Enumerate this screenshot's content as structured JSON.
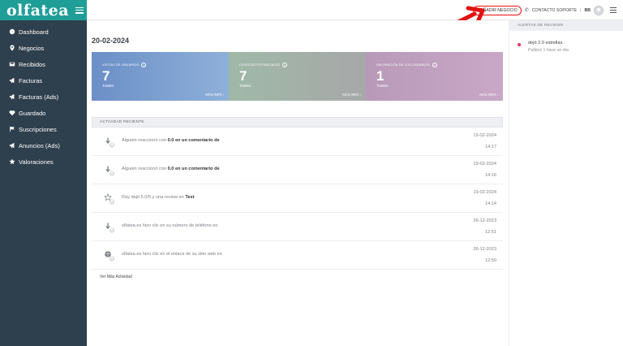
{
  "brand": {
    "logo": "olfatea"
  },
  "sidebar": {
    "items": [
      {
        "label": "Dashboard",
        "icon": "dashboard-icon"
      },
      {
        "label": "Negocios",
        "icon": "map-pin-icon"
      },
      {
        "label": "Recibidos",
        "icon": "envelope-icon"
      },
      {
        "label": "Facturas",
        "icon": "megaphone-icon"
      },
      {
        "label": "Facturas (Ads)",
        "icon": "megaphone-icon"
      },
      {
        "label": "Guardado",
        "icon": "heart-icon"
      },
      {
        "label": "Suscripciones",
        "icon": "flag-icon"
      },
      {
        "label": "Anuncios (Ads)",
        "icon": "megaphone-icon"
      },
      {
        "label": "Valoraciones",
        "icon": "star-icon"
      }
    ]
  },
  "topbar": {
    "add_business": "+ AÑADIR NEGOCIO",
    "contact_support": "CONTACTO SOPORTE",
    "separator": "|",
    "user_initials": "BB"
  },
  "main": {
    "date": "20-02-2024",
    "stats": [
      {
        "label": "VISITAS DE USUARIOS",
        "value": "7",
        "sub": "Totales",
        "more": "MÁS INFO  ›"
      },
      {
        "label": "CLIENTES POTENCIALES",
        "value": "7",
        "sub": "Totales",
        "more": "MÁS INFO  ›"
      },
      {
        "label": "VALORACIÓN DE LOS USUARIOS",
        "value": "1",
        "sub": "Totales",
        "more": "MÁS INFO  ›"
      }
    ],
    "activity": {
      "title": "ACTIVIDAD RECIENTE",
      "rows": [
        {
          "icon": "thumb-icon",
          "prefix": "Alguien reaccionó con ",
          "bold": "0.0 en un comentario de",
          "date": "19-02-2024",
          "time": "14:17"
        },
        {
          "icon": "thumb-icon",
          "prefix": "Alguien reaccionó con ",
          "bold": "0.0 en un comentario de",
          "date": "19-02-2024",
          "time": "14:16"
        },
        {
          "icon": "star-outline-icon",
          "prefix": "Ray dejó 5.0/5 y una review en ",
          "bold": "Test",
          "date": "19-02-2024",
          "time": "14:14"
        },
        {
          "icon": "thumb-icon",
          "prefix": "olfatea.es hizo clic en su número de teléfono en",
          "bold": "",
          "date": "26-12-2023",
          "time": "12:51"
        },
        {
          "icon": "globe-icon",
          "prefix": "olfatea.es hizo clic en el enlace de su sitio web en",
          "bold": "",
          "date": "26-12-2023",
          "time": "12:50"
        }
      ],
      "see_more": "Ver Más Actividad"
    }
  },
  "reviews_panel": {
    "title": "ALERTAS DE REVIEWS",
    "item": {
      "text": "dejó 2.0 estrellas.",
      "sub": "Publicó 1 hace un día"
    }
  },
  "colors": {
    "brand": "#1f9e98",
    "sidebar": "#2e3f4d",
    "annotation": "#e11111"
  }
}
